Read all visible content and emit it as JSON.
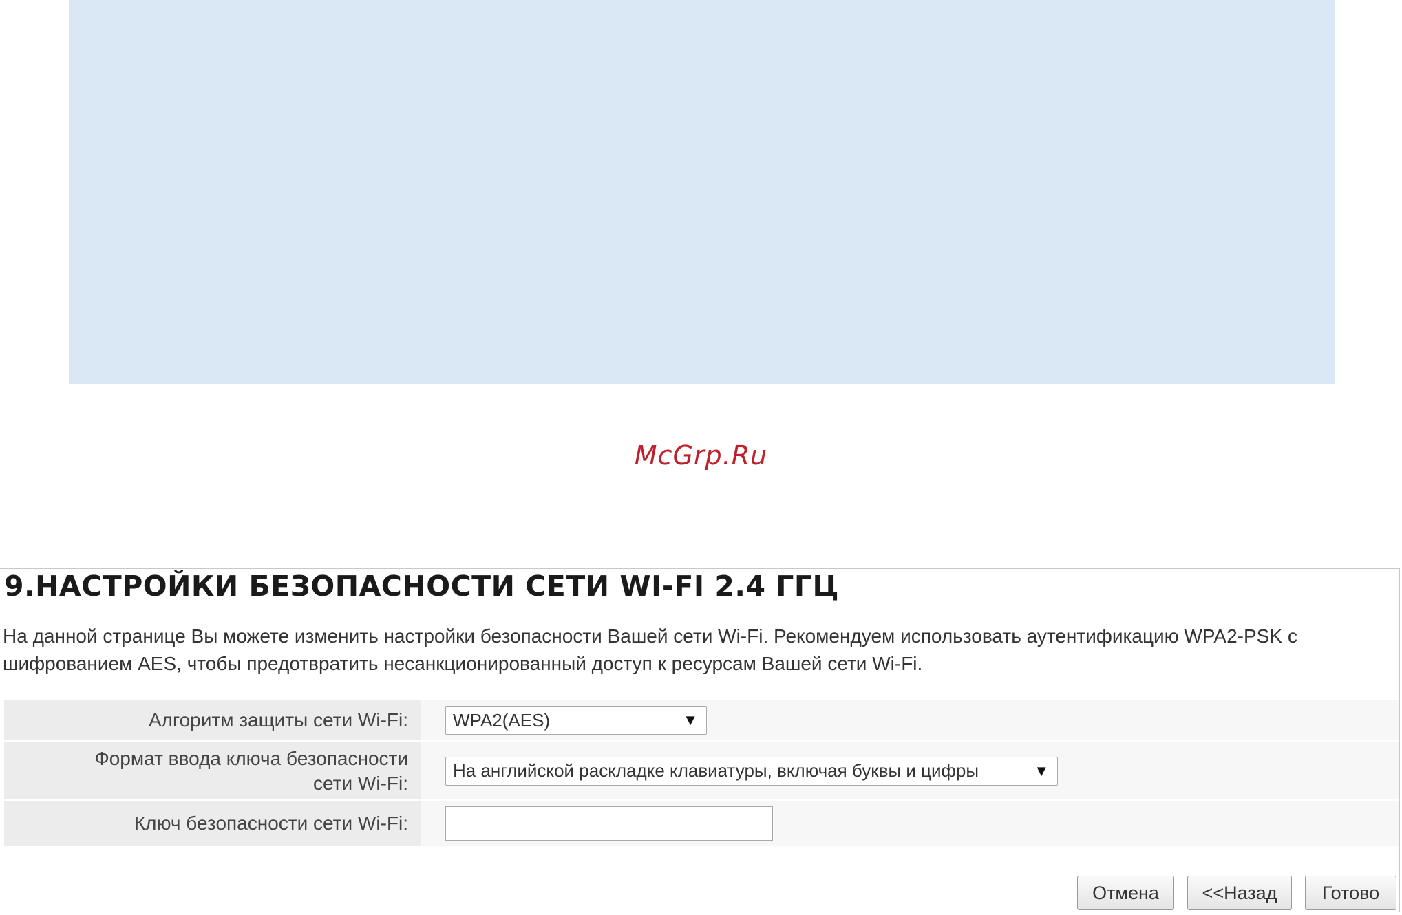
{
  "watermark": "McGrp.Ru",
  "page": {
    "title": "9.НАСТРОЙКИ БЕЗОПАСНОСТИ СЕТИ WI-FI 2.4 ГГЦ",
    "intro": "На данной странице Вы можете изменить настройки безопасности Вашей сети Wi-Fi. Рекомендуем использовать аутентификацию WPA2-PSK с шифрованием AES, чтобы предотвратить несанкционированный доступ к ресурсам Вашей сети Wi-Fi."
  },
  "form": {
    "security_algorithm": {
      "label": "Алгоритм защиты сети Wi-Fi:",
      "value": "WPA2(AES)",
      "arrow": "▼"
    },
    "key_format": {
      "label_line1": "Формат ввода ключа безопасности",
      "label_line2": "сети Wi-Fi:",
      "value": "На английской раскладке клавиатуры, включая буквы и цифры",
      "arrow": "▼"
    },
    "security_key": {
      "label": "Ключ безопасности сети Wi-Fi:",
      "value": ""
    }
  },
  "buttons": {
    "cancel": "Отмена",
    "back": "<<Назад",
    "done": "Готово"
  },
  "colors": {
    "info_panel": "#d9e8f4",
    "watermark": "#c0202a",
    "label_bg": "#ececec",
    "field_bg": "#f7f7f7"
  },
  "icons": {
    "select_arrow": "chevron-down-icon"
  }
}
